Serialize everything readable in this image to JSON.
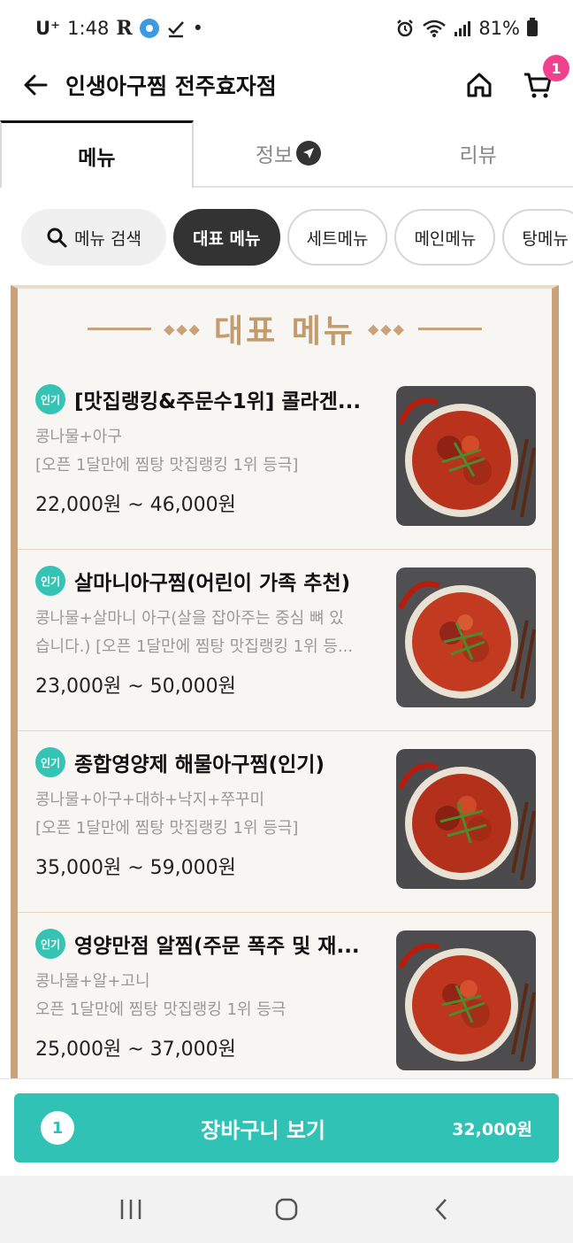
{
  "status_bar": {
    "carrier": "U⁺",
    "time": "1:48",
    "r_label": "R",
    "dot": "•",
    "battery": "81%"
  },
  "header": {
    "title": "인생아구찜 전주효자점",
    "cart_badge": "1"
  },
  "tabs": [
    {
      "label": "메뉴"
    },
    {
      "label": "정보"
    },
    {
      "label": "리뷰"
    }
  ],
  "chips": {
    "search": "메뉴 검색",
    "items": [
      {
        "label": "대표 메뉴"
      },
      {
        "label": "세트메뉴"
      },
      {
        "label": "메인메뉴"
      },
      {
        "label": "탕메뉴"
      }
    ]
  },
  "section": {
    "heading": "대표 메뉴",
    "diamonds": "◆◆◆"
  },
  "menu_items": [
    {
      "badge": "인기",
      "name": "[맛집랭킹&주문수1위] 콜라겐...",
      "desc1": "콩나물+아구",
      "desc2": "[오픈 1달만에 찜탕 맛집랭킹 1위 등극]",
      "price": "22,000원 ~ 46,000원"
    },
    {
      "badge": "인기",
      "name": "살마니아구찜(어린이 가족 추천)",
      "desc1": "콩나물+살마니 아구(살을 잡아주는 중심 뼈 있",
      "desc2": "습니다.) [오픈 1달만에 찜탕 맛집랭킹 1위 등...",
      "price": "23,000원 ~ 50,000원"
    },
    {
      "badge": "인기",
      "name": "종합영양제 해물아구찜(인기)",
      "desc1": "콩나물+아구+대하+낙지+쭈꾸미",
      "desc2": "[오픈 1달만에 찜탕 맛집랭킹 1위 등극]",
      "price": "35,000원 ~ 59,000원"
    },
    {
      "badge": "인기",
      "name": "영양만점 알찜(주문 폭주 및 재...",
      "desc1": "콩나물+알+고니",
      "desc2": "오픈 1달만에 찜탕 맛집랭킹 1위 등극",
      "price": "25,000원 ~ 37,000원"
    }
  ],
  "cart": {
    "count": "1",
    "label": "장바구니 보기",
    "total": "32,000원"
  },
  "colors": {
    "accent": "#2fc2b5",
    "gold": "#c9a27a",
    "badge_pink": "#f0418f"
  }
}
